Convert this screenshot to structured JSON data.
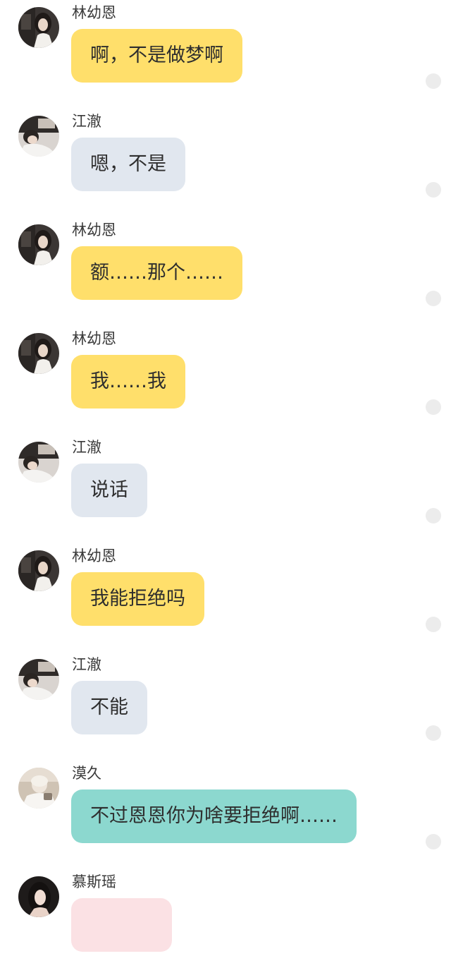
{
  "colors": {
    "bubble_yellow": "#ffdf6b",
    "bubble_gray": "#e1e7ef",
    "bubble_teal": "#8cd8cf",
    "bubble_pink": "#fbe1e4",
    "dot": "#ececec",
    "name_text": "#3a3a3a",
    "message_text": "#2e2e2e"
  },
  "messages": [
    {
      "sender": "林幼恩",
      "text": "啊，不是做梦啊",
      "avatar": "linyouen-avatar",
      "bubble_color": "#ffdf6b"
    },
    {
      "sender": "江澈",
      "text": "嗯，不是",
      "avatar": "jiangche-avatar",
      "bubble_color": "#e1e7ef"
    },
    {
      "sender": "林幼恩",
      "text": "额……那个……",
      "avatar": "linyouen-avatar",
      "bubble_color": "#ffdf6b"
    },
    {
      "sender": "林幼恩",
      "text": "我……我",
      "avatar": "linyouen-avatar",
      "bubble_color": "#ffdf6b"
    },
    {
      "sender": "江澈",
      "text": "说话",
      "avatar": "jiangche-avatar",
      "bubble_color": "#e1e7ef"
    },
    {
      "sender": "林幼恩",
      "text": "我能拒绝吗",
      "avatar": "linyouen-avatar",
      "bubble_color": "#ffdf6b"
    },
    {
      "sender": "江澈",
      "text": "不能",
      "avatar": "jiangche-avatar",
      "bubble_color": "#e1e7ef"
    },
    {
      "sender": "漠久",
      "text": "不过恩恩你为啥要拒绝啊……",
      "avatar": "mojiu-avatar",
      "bubble_color": "#8cd8cf"
    },
    {
      "sender": "慕斯瑶",
      "text": "",
      "avatar": "musiyao-avatar",
      "bubble_color": "#fbe1e4"
    }
  ]
}
